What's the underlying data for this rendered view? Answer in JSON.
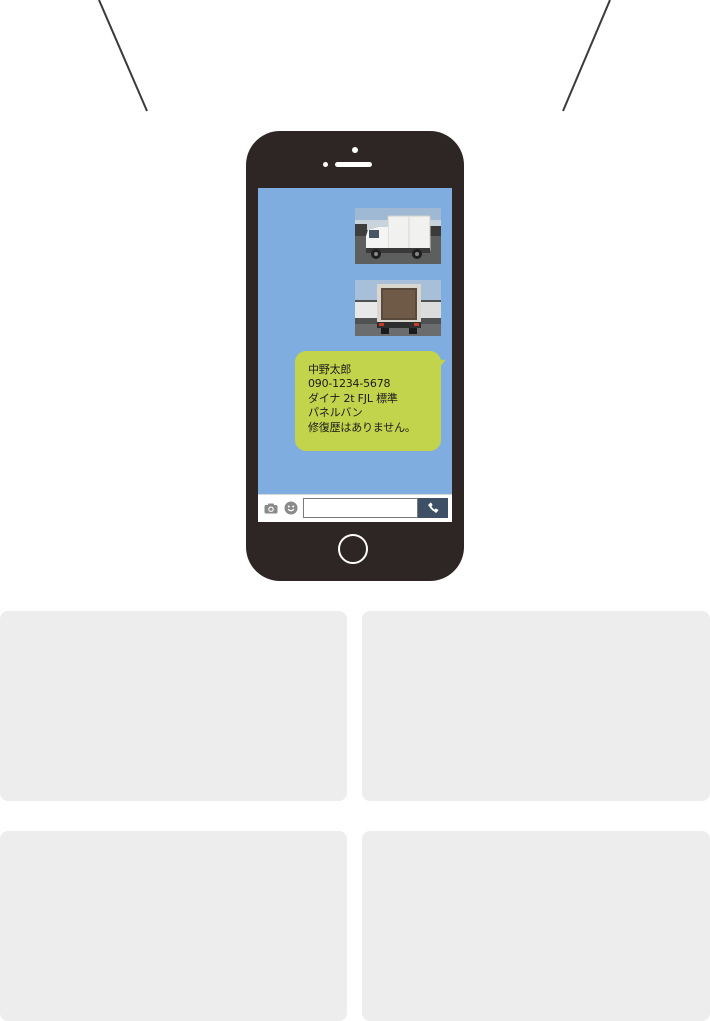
{
  "colors": {
    "phone_body": "#2d2625",
    "screen_background": "#7fade0",
    "bubble_background": "#c2d44c",
    "send_button": "#3e5066",
    "panel_background": "#ededed"
  },
  "chat": {
    "photos": [
      {
        "alt": "truck-side-photo"
      },
      {
        "alt": "truck-rear-photo"
      }
    ],
    "message": {
      "line1": "中野太郎",
      "line2": "090-1234-5678",
      "line3": "ダイナ 2t FJL 標準",
      "line4": "パネルバン",
      "line5": "修復歴はありません。"
    }
  },
  "input_bar": {
    "input_value": "",
    "icons": [
      "camera-icon",
      "smile-icon",
      "phone-icon"
    ]
  }
}
